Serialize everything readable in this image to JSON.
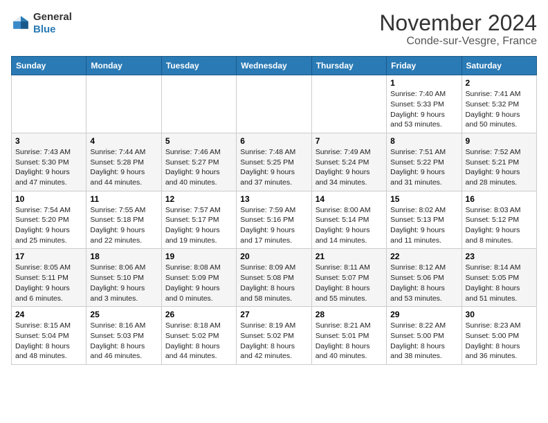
{
  "logo": {
    "line1": "General",
    "line2": "Blue"
  },
  "title": "November 2024",
  "subtitle": "Conde-sur-Vesgre, France",
  "days_of_week": [
    "Sunday",
    "Monday",
    "Tuesday",
    "Wednesday",
    "Thursday",
    "Friday",
    "Saturday"
  ],
  "weeks": [
    [
      {
        "day": "",
        "info": ""
      },
      {
        "day": "",
        "info": ""
      },
      {
        "day": "",
        "info": ""
      },
      {
        "day": "",
        "info": ""
      },
      {
        "day": "",
        "info": ""
      },
      {
        "day": "1",
        "info": "Sunrise: 7:40 AM\nSunset: 5:33 PM\nDaylight: 9 hours\nand 53 minutes."
      },
      {
        "day": "2",
        "info": "Sunrise: 7:41 AM\nSunset: 5:32 PM\nDaylight: 9 hours\nand 50 minutes."
      }
    ],
    [
      {
        "day": "3",
        "info": "Sunrise: 7:43 AM\nSunset: 5:30 PM\nDaylight: 9 hours\nand 47 minutes."
      },
      {
        "day": "4",
        "info": "Sunrise: 7:44 AM\nSunset: 5:28 PM\nDaylight: 9 hours\nand 44 minutes."
      },
      {
        "day": "5",
        "info": "Sunrise: 7:46 AM\nSunset: 5:27 PM\nDaylight: 9 hours\nand 40 minutes."
      },
      {
        "day": "6",
        "info": "Sunrise: 7:48 AM\nSunset: 5:25 PM\nDaylight: 9 hours\nand 37 minutes."
      },
      {
        "day": "7",
        "info": "Sunrise: 7:49 AM\nSunset: 5:24 PM\nDaylight: 9 hours\nand 34 minutes."
      },
      {
        "day": "8",
        "info": "Sunrise: 7:51 AM\nSunset: 5:22 PM\nDaylight: 9 hours\nand 31 minutes."
      },
      {
        "day": "9",
        "info": "Sunrise: 7:52 AM\nSunset: 5:21 PM\nDaylight: 9 hours\nand 28 minutes."
      }
    ],
    [
      {
        "day": "10",
        "info": "Sunrise: 7:54 AM\nSunset: 5:20 PM\nDaylight: 9 hours\nand 25 minutes."
      },
      {
        "day": "11",
        "info": "Sunrise: 7:55 AM\nSunset: 5:18 PM\nDaylight: 9 hours\nand 22 minutes."
      },
      {
        "day": "12",
        "info": "Sunrise: 7:57 AM\nSunset: 5:17 PM\nDaylight: 9 hours\nand 19 minutes."
      },
      {
        "day": "13",
        "info": "Sunrise: 7:59 AM\nSunset: 5:16 PM\nDaylight: 9 hours\nand 17 minutes."
      },
      {
        "day": "14",
        "info": "Sunrise: 8:00 AM\nSunset: 5:14 PM\nDaylight: 9 hours\nand 14 minutes."
      },
      {
        "day": "15",
        "info": "Sunrise: 8:02 AM\nSunset: 5:13 PM\nDaylight: 9 hours\nand 11 minutes."
      },
      {
        "day": "16",
        "info": "Sunrise: 8:03 AM\nSunset: 5:12 PM\nDaylight: 9 hours\nand 8 minutes."
      }
    ],
    [
      {
        "day": "17",
        "info": "Sunrise: 8:05 AM\nSunset: 5:11 PM\nDaylight: 9 hours\nand 6 minutes."
      },
      {
        "day": "18",
        "info": "Sunrise: 8:06 AM\nSunset: 5:10 PM\nDaylight: 9 hours\nand 3 minutes."
      },
      {
        "day": "19",
        "info": "Sunrise: 8:08 AM\nSunset: 5:09 PM\nDaylight: 9 hours\nand 0 minutes."
      },
      {
        "day": "20",
        "info": "Sunrise: 8:09 AM\nSunset: 5:08 PM\nDaylight: 8 hours\nand 58 minutes."
      },
      {
        "day": "21",
        "info": "Sunrise: 8:11 AM\nSunset: 5:07 PM\nDaylight: 8 hours\nand 55 minutes."
      },
      {
        "day": "22",
        "info": "Sunrise: 8:12 AM\nSunset: 5:06 PM\nDaylight: 8 hours\nand 53 minutes."
      },
      {
        "day": "23",
        "info": "Sunrise: 8:14 AM\nSunset: 5:05 PM\nDaylight: 8 hours\nand 51 minutes."
      }
    ],
    [
      {
        "day": "24",
        "info": "Sunrise: 8:15 AM\nSunset: 5:04 PM\nDaylight: 8 hours\nand 48 minutes."
      },
      {
        "day": "25",
        "info": "Sunrise: 8:16 AM\nSunset: 5:03 PM\nDaylight: 8 hours\nand 46 minutes."
      },
      {
        "day": "26",
        "info": "Sunrise: 8:18 AM\nSunset: 5:02 PM\nDaylight: 8 hours\nand 44 minutes."
      },
      {
        "day": "27",
        "info": "Sunrise: 8:19 AM\nSunset: 5:02 PM\nDaylight: 8 hours\nand 42 minutes."
      },
      {
        "day": "28",
        "info": "Sunrise: 8:21 AM\nSunset: 5:01 PM\nDaylight: 8 hours\nand 40 minutes."
      },
      {
        "day": "29",
        "info": "Sunrise: 8:22 AM\nSunset: 5:00 PM\nDaylight: 8 hours\nand 38 minutes."
      },
      {
        "day": "30",
        "info": "Sunrise: 8:23 AM\nSunset: 5:00 PM\nDaylight: 8 hours\nand 36 minutes."
      }
    ]
  ]
}
